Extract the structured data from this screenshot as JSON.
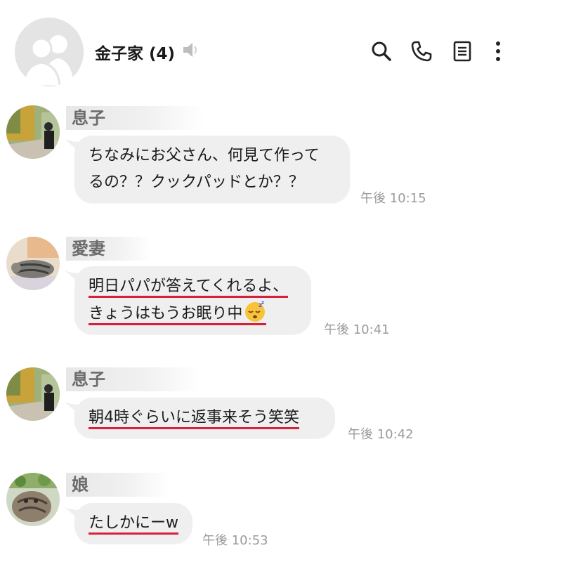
{
  "header": {
    "title": "金子家 (4)",
    "icons": [
      "group-avatar",
      "speaker-muted-icon",
      "search-icon",
      "phone-icon",
      "notes-icon",
      "more-vertical-icon"
    ]
  },
  "messages": [
    {
      "sender": "息子",
      "avatar": "son-avatar",
      "lines": [
        "ちなみにお父さん、何見て作って",
        "るの？？クックパッドとか？？"
      ],
      "time": "午後 10:15"
    },
    {
      "sender": "愛妻",
      "avatar": "wife-avatar-cat",
      "lines": [
        "明日パパが答えてくれるよ、",
        "きょうはもうお眠り中"
      ],
      "emoji": "sleeping-face",
      "time": "午後 10:41"
    },
    {
      "sender": "息子",
      "avatar": "son-avatar",
      "lines": [
        "朝4時ぐらいに返事来そう笑笑"
      ],
      "time": "午後 10:42"
    },
    {
      "sender": "娘",
      "avatar": "daughter-avatar-cat",
      "lines": [
        "たしかにーw"
      ],
      "time": "午後 10:53"
    }
  ],
  "colors": {
    "bubble": "#efefef",
    "underline": "#d9203a",
    "timestamp": "#9a9a9a",
    "sender": "#6b6b6b"
  }
}
